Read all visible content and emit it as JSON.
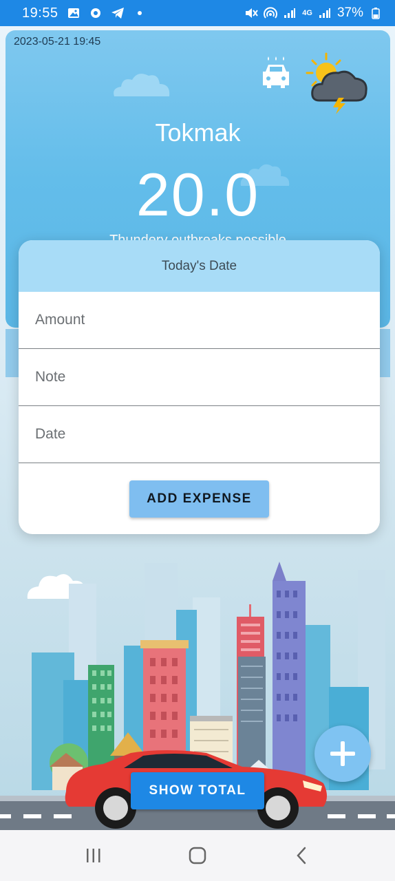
{
  "status_bar": {
    "time": "19:55",
    "battery": "37%",
    "network": "4G",
    "icons": [
      "gallery-icon",
      "vpn-icon",
      "telegram-icon",
      "dot-icon",
      "mute-icon",
      "hotspot-icon",
      "signal-icon",
      "battery-icon"
    ]
  },
  "weather": {
    "timestamp": "2023-05-21 19:45",
    "city": "Tokmak",
    "temperature": "20.0",
    "condition": "Thundery outbreaks possible",
    "icons": [
      "car-wash-icon",
      "thunderstorm-icon"
    ]
  },
  "dialog": {
    "header": "Today's Date",
    "fields": {
      "amount_placeholder": "Amount",
      "note_placeholder": "Note",
      "date_placeholder": "Date"
    },
    "add_button": "ADD EXPENSE"
  },
  "actions": {
    "show_total": "SHOW TOTAL",
    "fab_icon": "plus-icon"
  },
  "navigation": [
    "recents-icon",
    "home-icon",
    "back-icon"
  ],
  "colors": {
    "status_bar": "#1e88e5",
    "dialog_header": "#a8dcf7",
    "add_button": "#7fbef0",
    "show_total_button": "#1e88e5",
    "fab": "#7fc3f2"
  }
}
